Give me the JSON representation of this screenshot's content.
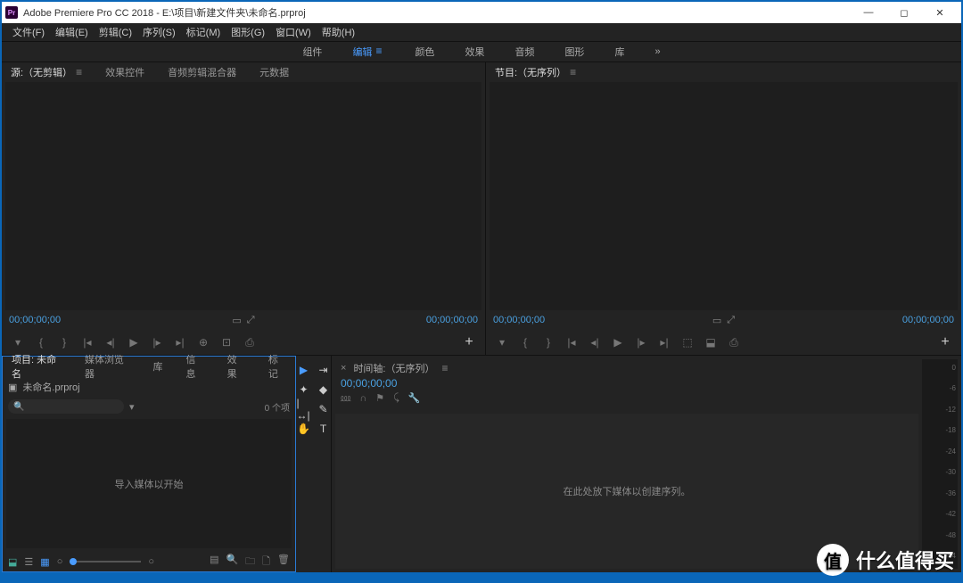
{
  "titlebar": {
    "logo_text": "Pr",
    "title": "Adobe Premiere Pro CC 2018 - E:\\项目\\新建文件夹\\未命名.prproj"
  },
  "menubar": {
    "items": [
      "文件(F)",
      "编辑(E)",
      "剪辑(C)",
      "序列(S)",
      "标记(M)",
      "图形(G)",
      "窗口(W)",
      "帮助(H)"
    ]
  },
  "workspaces": {
    "items": [
      "组件",
      "编辑",
      "颜色",
      "效果",
      "音频",
      "图形",
      "库"
    ],
    "active_index": 1,
    "overflow": "»"
  },
  "source_panel": {
    "tabs": [
      "源:（无剪辑）",
      "效果控件",
      "音频剪辑混合器",
      "元数据"
    ],
    "active_index": 0,
    "tc_left": "00;00;00;00",
    "tc_right": "00;00;00;00"
  },
  "program_panel": {
    "tab": "节目:（无序列）",
    "tc_left": "00;00;00;00",
    "tc_right": "00;00;00;00"
  },
  "project_panel": {
    "tabs": [
      "项目: 未命名",
      "媒体浏览器",
      "库",
      "信息",
      "效果",
      "标记"
    ],
    "active_index": 0,
    "project_file": "未命名.prproj",
    "item_count": "0 个项",
    "empty_text": "导入媒体以开始"
  },
  "timeline_panel": {
    "title": "时间轴:（无序列）",
    "tc": "00;00;00;00",
    "empty_text": "在此处放下媒体以创建序列。"
  },
  "audiometer": {
    "ticks": [
      "0",
      "-6",
      "-12",
      "-18",
      "-24",
      "-30",
      "-36",
      "-42",
      "-48",
      "-54"
    ]
  },
  "watermark": {
    "icon": "值",
    "text": "什么值得买"
  }
}
